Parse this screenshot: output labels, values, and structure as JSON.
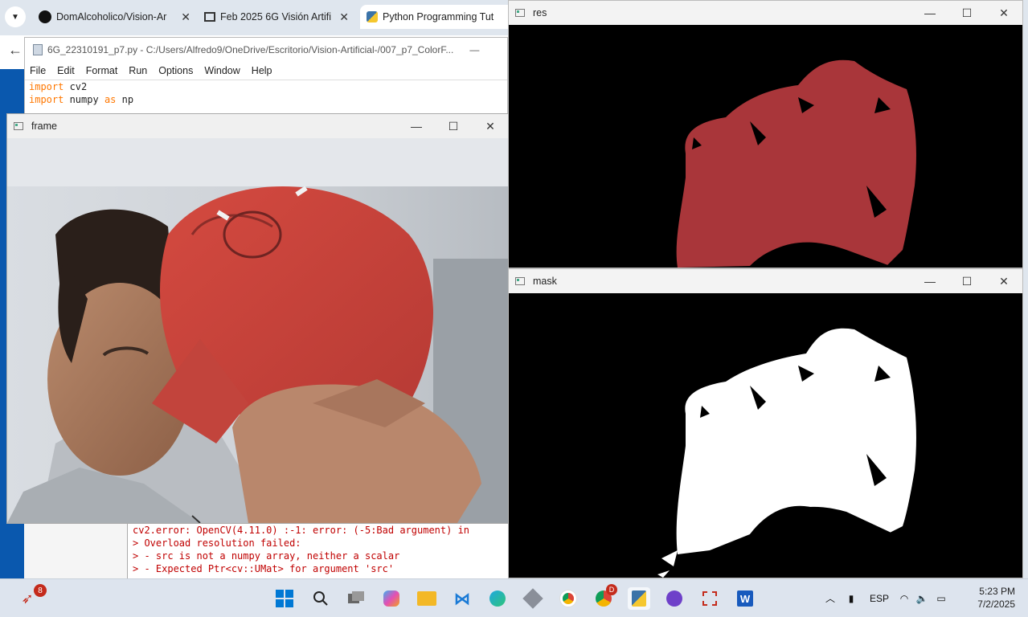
{
  "browser": {
    "tabs": [
      {
        "title": "DomAlcoholico/Vision-Ar",
        "icon": "github-icon"
      },
      {
        "title": "Feb 2025 6G Visión Artifi",
        "icon": "classroom-icon"
      },
      {
        "title": "Python Programming Tut",
        "icon": "python-icon"
      }
    ],
    "close_glyph": "✕"
  },
  "idle": {
    "title": "6G_22310191_p7.py - C:/Users/Alfredo9/OneDrive/Escritorio/Vision-Artificial-/007_p7_ColorF...",
    "menu": [
      "File",
      "Edit",
      "Format",
      "Run",
      "Options",
      "Window",
      "Help"
    ],
    "code_lines": [
      {
        "kw": "import",
        "rest": " cv2",
        "kw2": "",
        "rest2": ""
      },
      {
        "kw": "import",
        "rest": " numpy ",
        "kw2": "as",
        "rest2": " np"
      }
    ]
  },
  "shell": {
    "lines": [
      "cv2.error: OpenCV(4.11.0) :-1: error: (-5:Bad argument) in",
      "> Overload resolution failed:",
      ">  - src is not a numpy array, neither a scalar",
      ">  - Expected Ptr<cv::UMat> for argument 'src'"
    ]
  },
  "windows": {
    "frame": {
      "title": "frame"
    },
    "res": {
      "title": "res"
    },
    "mask": {
      "title": "mask"
    }
  },
  "taskbar": {
    "notification_count": "8",
    "chrome_profile_badge": "D",
    "language": "ESP",
    "time": "5:23 PM",
    "date": "7/2/2025",
    "apps": [
      "start-icon",
      "search-icon",
      "task-view-icon",
      "copilot-icon",
      "file-explorer-icon",
      "vscode-icon",
      "edge-icon",
      "virtualbox-icon",
      "chrome-icon",
      "chrome-profile-icon",
      "python-idle-icon",
      "github-desktop-icon",
      "snipping-tool-icon",
      "word-icon"
    ]
  },
  "colors": {
    "cap_red": "#c8423c",
    "res_red": "#a9363a",
    "accent_blue": "#0a58ae",
    "error_red": "#c00000"
  }
}
